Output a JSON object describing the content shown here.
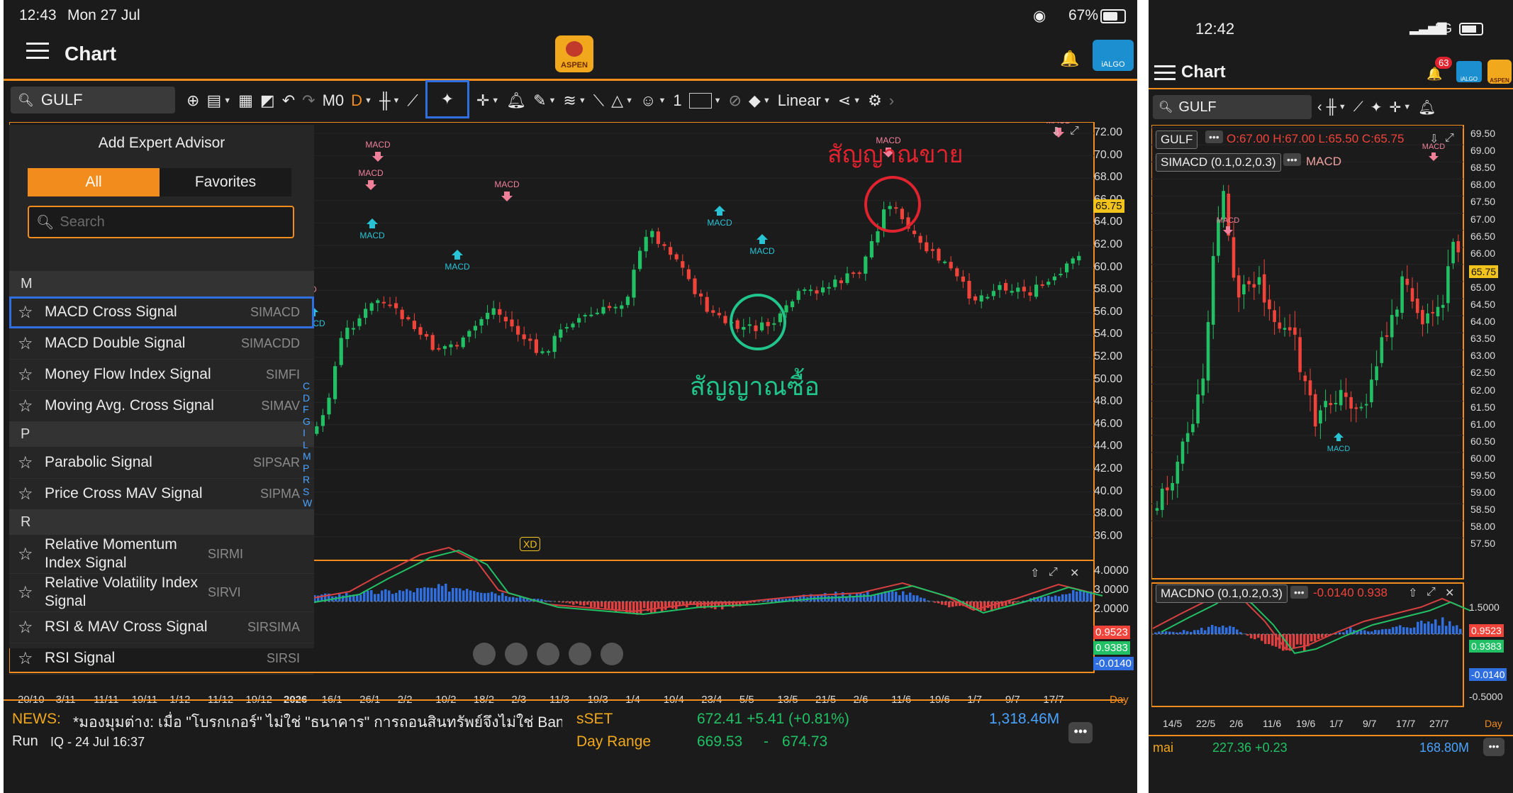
{
  "tablet": {
    "status": {
      "time": "12:43",
      "date": "Mon 27 Jul",
      "battery": "67%"
    },
    "header": {
      "title": "Chart",
      "brand_logo": "ASPEN",
      "algo_logo": "iALGO"
    },
    "toolbar": {
      "symbol": "GULF",
      "interval_m0": "M0",
      "interval_d": "D",
      "zoom_value": "1",
      "scale_mode": "Linear"
    },
    "expert_panel": {
      "title": "Add Expert Advisor",
      "tabs": [
        {
          "label": "All",
          "active": true
        },
        {
          "label": "Favorites",
          "active": false
        }
      ],
      "search_placeholder": "Search",
      "groups": [
        {
          "letter": "M",
          "items": [
            {
              "name": "MACD Cross Signal",
              "code": "SIMACD",
              "selected": true
            },
            {
              "name": "MACD Double Signal",
              "code": "SIMACDD"
            },
            {
              "name": "Money Flow Index Signal",
              "code": "SIMFI"
            },
            {
              "name": "Moving Avg. Cross Signal",
              "code": "SIMAV"
            }
          ]
        },
        {
          "letter": "P",
          "items": [
            {
              "name": "Parabolic Signal",
              "code": "SIPSAR"
            },
            {
              "name": "Price Cross MAV Signal",
              "code": "SIPMA"
            }
          ]
        },
        {
          "letter": "R",
          "items": [
            {
              "name": "Relative Momentum Index Signal",
              "code": "SIRMI"
            },
            {
              "name": "Relative Volatility Index Signal",
              "code": "SIRVI"
            },
            {
              "name": "RSI & MAV Cross Signal",
              "code": "SIRSIMA"
            },
            {
              "name": "RSI Signal",
              "code": "SIRSI"
            }
          ]
        }
      ],
      "alpha_index": [
        "C",
        "D",
        "F",
        "G",
        "I",
        "L",
        "M",
        "P",
        "R",
        "S",
        "W"
      ]
    },
    "chart": {
      "price_axis": [
        "72.00",
        "70.00",
        "68.00",
        "66.00",
        "64.00",
        "62.00",
        "60.00",
        "58.00",
        "56.00",
        "54.00",
        "52.00",
        "50.00",
        "48.00",
        "46.00",
        "44.00",
        "42.00",
        "40.00",
        "38.00",
        "36.00"
      ],
      "last_price": "65.75",
      "macd_axis": [
        "4.0000",
        "3.0000",
        "2.0000"
      ],
      "macd_tags": [
        "0.9523",
        "0.9383",
        "-0.0140"
      ],
      "date_axis": [
        "20/10",
        "3/11",
        "11/11",
        "19/11",
        "1/12",
        "11/12",
        "19/12",
        "2026",
        "16/1",
        "26/1",
        "2/2",
        "10/2",
        "18/2",
        "2/3",
        "11/3",
        "19/3",
        "1/4",
        "10/4",
        "23/4",
        "5/5",
        "13/5",
        "21/5",
        "2/6",
        "11/6",
        "19/6",
        "1/7",
        "9/7",
        "17/7"
      ],
      "period": "Day",
      "signal_label": "MACD",
      "sell_annotation": "สัญญาณขาย",
      "buy_annotation": "สัญญาณซื้อ",
      "xd_badge": "XD",
      "colors": {
        "up": "#21c064",
        "down": "#f0433a",
        "accent": "#f28c1d",
        "highlight": "#2f6fe0",
        "sell": "#e0232e",
        "buy": "#21c48a"
      }
    },
    "news": {
      "label": "NEWS:",
      "headline": "*มองมุมต่าง: เมื่อ \"โบรกเกอร์\" ไม่ใช่ \"ธนาคาร\" การถอนสินทรัพย์จึงไม่ใช่ Bank",
      "line2_a": "Run",
      "source": "IQ - 24 Jul 16:37"
    },
    "market": {
      "index_name": "sSET",
      "index_value": "672.41 +5.41 (+0.81%)",
      "volume": "1,318.46M",
      "range_label": "Day Range",
      "range_low": "669.53",
      "range_sep": "-",
      "range_high": "674.73"
    }
  },
  "phone": {
    "status": {
      "time": "12:42",
      "network": "5G"
    },
    "header": {
      "title": "Chart",
      "notification_count": "63",
      "algo_logo": "iALGO",
      "brand_logo": "ASPEN"
    },
    "toolbar": {
      "symbol": "GULF"
    },
    "chart": {
      "legend_symbol": "GULF",
      "ohlc": "O:67.00 H:67.00 L:65.50 C:65.75",
      "indicator": "SIMACD (0.1,0.2,0.3)",
      "indicator_tag": "MACD",
      "price_axis": [
        "69.50",
        "69.00",
        "68.50",
        "68.00",
        "67.50",
        "67.00",
        "66.50",
        "66.00",
        "65.50",
        "65.00",
        "64.50",
        "64.00",
        "63.50",
        "63.00",
        "62.50",
        "62.00",
        "61.50",
        "61.00",
        "60.50",
        "60.00",
        "59.50",
        "59.00",
        "58.50",
        "58.00",
        "57.50"
      ],
      "last_price": "65.75",
      "macd_legend": "MACDNO (0.1,0.2,0.3)",
      "macd_values": "-0.0140 0.938",
      "macd_axis": [
        "1.5000",
        "-0.5000"
      ],
      "macd_tags": [
        "0.9523",
        "0.9383",
        "-0.0140"
      ],
      "date_axis": [
        "14/5",
        "22/5",
        "2/6",
        "11/6",
        "19/6",
        "1/7",
        "9/7",
        "17/7",
        "27/7"
      ],
      "period": "Day",
      "signal_label": "MACD"
    },
    "market": {
      "index_name": "mai",
      "index_value": "227.36 +0.23",
      "volume": "168.80M"
    }
  }
}
